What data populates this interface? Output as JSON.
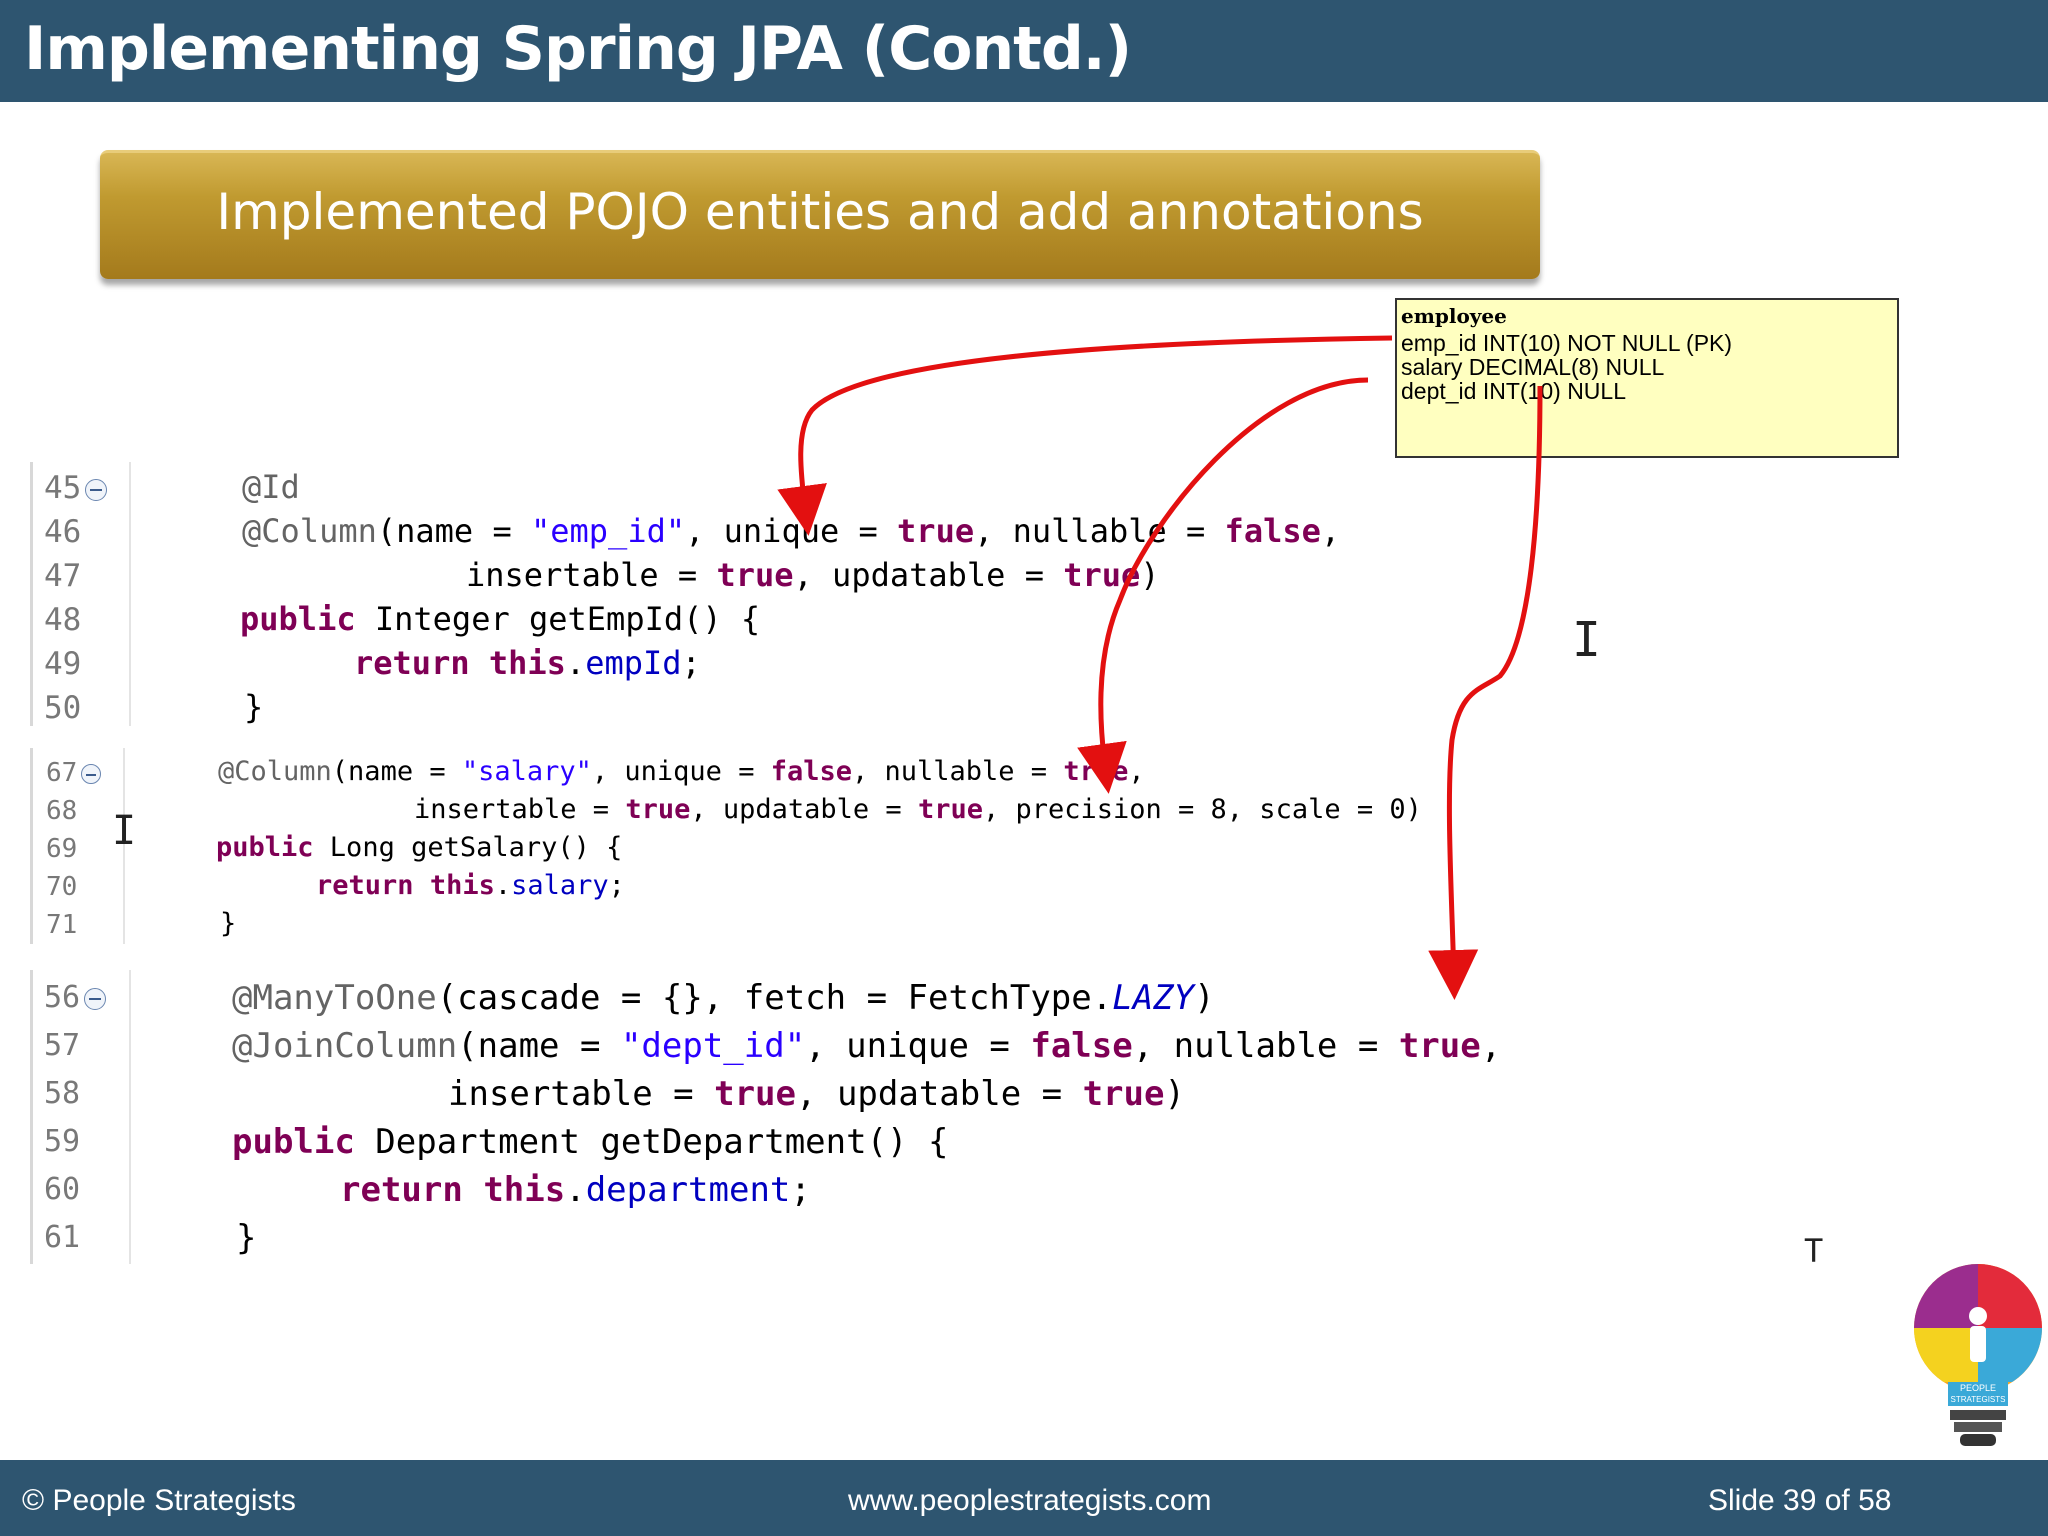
{
  "slide": {
    "title": "Implementing Spring JPA (Contd.)",
    "banner": "Implemented POJO entities and add annotations"
  },
  "table": {
    "name": "employee",
    "columns": [
      "emp_id  INT(10) NOT NULL (PK)",
      "salary  DECIMAL(8) NULL",
      "dept_id  INT(10) NULL"
    ]
  },
  "code_block_1": {
    "line_numbers": [
      "45",
      "46",
      "47",
      "48",
      "49",
      "50"
    ],
    "tokens": {
      "l45_ann": "@Id",
      "l46_ann": "@Column",
      "l46_a": "(name = ",
      "l46_str": "\"emp_id\"",
      "l46_b": ", unique = ",
      "l46_kw1": "true",
      "l46_c": ", nullable = ",
      "l46_kw2": "false",
      "l46_d": ",",
      "l47_a": "insertable = ",
      "l47_kw1": "true",
      "l47_b": ", updatable = ",
      "l47_kw2": "true",
      "l47_c": ")",
      "l48_kw": "public",
      "l48_a": " Integer getEmpId() {",
      "l49_kw1": "return",
      "l49_kw2": "this",
      "l49_fld": "empId",
      "l49_a": ";",
      "l50": "}"
    }
  },
  "code_block_2": {
    "line_numbers": [
      "67",
      "68",
      "69",
      "70",
      "71"
    ],
    "tokens": {
      "l67_ann": "@Column",
      "l67_a": "(name = ",
      "l67_str": "\"salary\"",
      "l67_b": ", unique = ",
      "l67_kw1": "false",
      "l67_c": ", nullable = ",
      "l67_kw2": "true",
      "l67_d": ",",
      "l68_a": "insertable = ",
      "l68_kw1": "true",
      "l68_b": ", updatable = ",
      "l68_kw2": "true",
      "l68_c": ", precision = 8, scale = 0)",
      "l69_kw": "public",
      "l69_a": " Long getSalary() {",
      "l70_kw1": "return",
      "l70_kw2": "this",
      "l70_fld": "salary",
      "l70_a": ";",
      "l71": "}"
    }
  },
  "code_block_3": {
    "line_numbers": [
      "56",
      "57",
      "58",
      "59",
      "60",
      "61"
    ],
    "tokens": {
      "l56_ann": "@ManyToOne",
      "l56_a": "(cascade = {}, fetch = FetchType.",
      "l56_it": "LAZY",
      "l56_b": ")",
      "l57_ann": "@JoinColumn",
      "l57_a": "(name = ",
      "l57_str": "\"dept_id\"",
      "l57_b": ", unique = ",
      "l57_kw1": "false",
      "l57_c": ", nullable = ",
      "l57_kw2": "true",
      "l57_d": ",",
      "l58_a": "insertable = ",
      "l58_kw1": "true",
      "l58_b": ", updatable = ",
      "l58_kw2": "true",
      "l58_c": ")",
      "l59_kw": "public",
      "l59_a": " Department getDepartment() {",
      "l60_kw1": "return",
      "l60_kw2": "this",
      "l60_fld": "department",
      "l60_a": ";",
      "l61": "}"
    }
  },
  "footer": {
    "copyright": "© People Strategists",
    "website": "www.peoplestrategists.com",
    "slide_counter": "Slide 39 of 58"
  },
  "logo": {
    "text_line1": "PEOPLE",
    "text_line2": "STRATEGISTS"
  },
  "colors": {
    "header_bg": "#2e5570",
    "banner_gold": "#b8902a",
    "arrow_red": "#e31010",
    "keyword": "#7f0055",
    "string": "#2a00ff"
  },
  "icons": [
    "text-cursor-icon",
    "fold-collapse-icon",
    "bulb-puzzle-logo"
  ]
}
